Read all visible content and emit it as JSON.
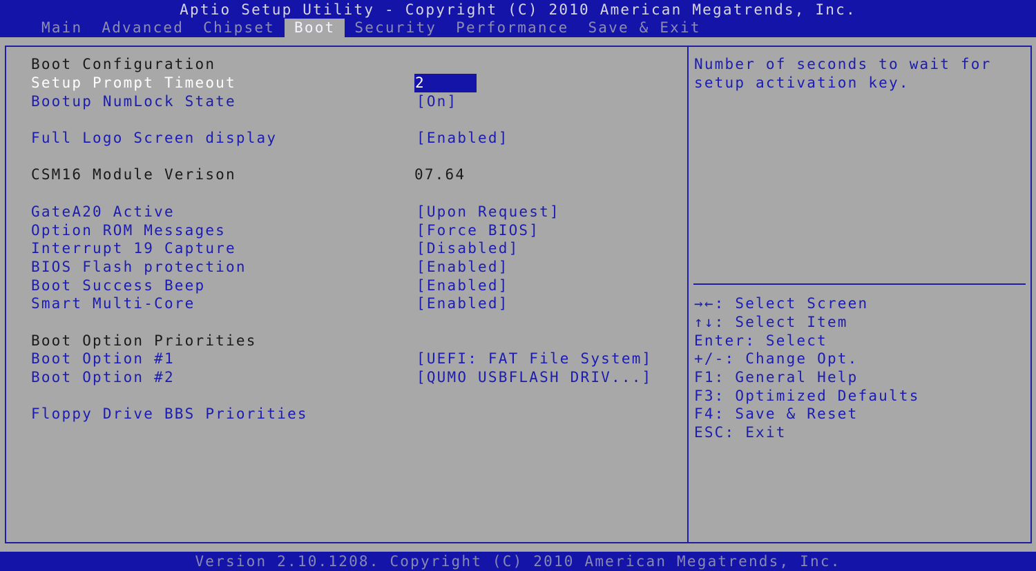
{
  "title": "Aptio Setup Utility - Copyright (C) 2010 American Megatrends, Inc.",
  "tabs": [
    "Main",
    "Advanced",
    "Chipset",
    "Boot",
    "Security",
    "Performance",
    "Save & Exit"
  ],
  "active_tab": "Boot",
  "section1": "Boot Configuration",
  "items": [
    {
      "label": "Setup Prompt Timeout",
      "value": "2"
    },
    {
      "label": "Bootup NumLock State",
      "value": "[On]"
    },
    {
      "label": "Full Logo Screen display",
      "value": "[Enabled]"
    },
    {
      "label": "CSM16 Module Verison",
      "value": "07.64"
    },
    {
      "label": "GateA20 Active",
      "value": "[Upon Request]"
    },
    {
      "label": "Option ROM Messages",
      "value": "[Force BIOS]"
    },
    {
      "label": "Interrupt 19 Capture",
      "value": "[Disabled]"
    },
    {
      "label": "BIOS Flash protection",
      "value": "[Enabled]"
    },
    {
      "label": "Boot Success Beep",
      "value": "[Enabled]"
    },
    {
      "label": "Smart Multi-Core",
      "value": "[Enabled]"
    }
  ],
  "section2": "Boot Option Priorities",
  "boot_options": [
    {
      "label": "Boot Option #1",
      "value": "[UEFI: FAT File System]"
    },
    {
      "label": "Boot Option #2",
      "value": "[QUMO USBFLASH DRIV...]"
    }
  ],
  "floppy": "Floppy Drive BBS Priorities",
  "help": [
    "Number of seconds to wait for",
    "setup activation key."
  ],
  "keys": [
    "→←: Select Screen",
    "↑↓: Select Item",
    "Enter: Select",
    "+/-: Change Opt.",
    "F1: General Help",
    "F3: Optimized Defaults",
    "F4: Save & Reset",
    "ESC: Exit"
  ],
  "footer": "Version 2.10.1208. Copyright (C) 2010 American Megatrends, Inc.",
  "colors": {
    "blue": "#1414a8",
    "gray": "#a8a8a8",
    "link": "#1c1cb0"
  }
}
